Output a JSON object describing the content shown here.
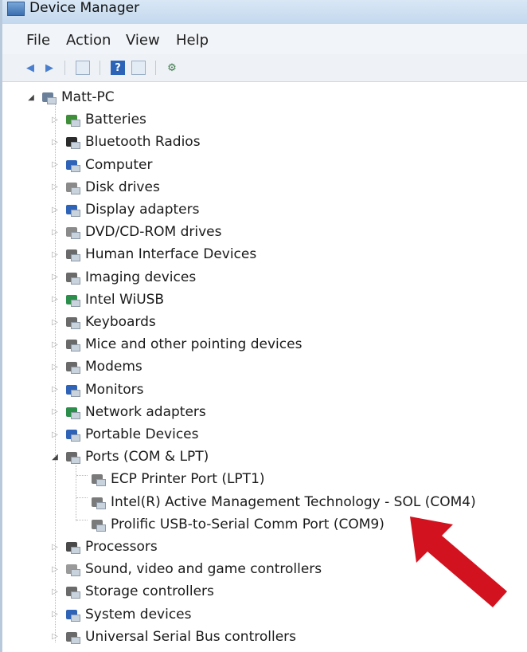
{
  "window": {
    "title": "Device Manager"
  },
  "menu": [
    "File",
    "Action",
    "View",
    "Help"
  ],
  "tree": {
    "root": "Matt-PC",
    "categories": [
      {
        "label": "Batteries",
        "icon": "battery-icon",
        "color": "#3f8f3a"
      },
      {
        "label": "Bluetooth Radios",
        "icon": "bluetooth-icon",
        "color": "#2b2b2b"
      },
      {
        "label": "Computer",
        "icon": "computer-icon",
        "color": "#2f63b7"
      },
      {
        "label": "Disk drives",
        "icon": "disk-drive-icon",
        "color": "#8a8a8a"
      },
      {
        "label": "Display adapters",
        "icon": "display-adapter-icon",
        "color": "#2f63b7"
      },
      {
        "label": "DVD/CD-ROM drives",
        "icon": "dvd-drive-icon",
        "color": "#8a8a8a"
      },
      {
        "label": "Human Interface Devices",
        "icon": "hid-icon",
        "color": "#6a6a6a"
      },
      {
        "label": "Imaging devices",
        "icon": "imaging-icon",
        "color": "#6a6a6a"
      },
      {
        "label": "Intel WiUSB",
        "icon": "network-icon",
        "color": "#2b8f4b"
      },
      {
        "label": "Keyboards",
        "icon": "keyboard-icon",
        "color": "#6a6a6a"
      },
      {
        "label": "Mice and other pointing devices",
        "icon": "mouse-icon",
        "color": "#6a6a6a"
      },
      {
        "label": "Modems",
        "icon": "modem-icon",
        "color": "#6a6a6a"
      },
      {
        "label": "Monitors",
        "icon": "monitor-icon",
        "color": "#2f63b7"
      },
      {
        "label": "Network adapters",
        "icon": "network-icon",
        "color": "#2b8f4b"
      },
      {
        "label": "Portable Devices",
        "icon": "portable-device-icon",
        "color": "#2f63b7"
      },
      {
        "label": "Ports (COM & LPT)",
        "icon": "port-icon",
        "color": "#6a6a6a",
        "expanded": true
      },
      {
        "label": "Processors",
        "icon": "processor-icon",
        "color": "#4a4a4a"
      },
      {
        "label": "Sound, video and game controllers",
        "icon": "sound-icon",
        "color": "#9a9a9a"
      },
      {
        "label": "Storage controllers",
        "icon": "storage-controller-icon",
        "color": "#6a6a6a"
      },
      {
        "label": "System devices",
        "icon": "system-device-icon",
        "color": "#2f63b7"
      },
      {
        "label": "Universal Serial Bus controllers",
        "icon": "usb-icon",
        "color": "#6a6a6a"
      }
    ],
    "ports_children": [
      "ECP Printer Port (LPT1)",
      "Intel(R) Active Management Technology - SOL (COM4)",
      "Prolific USB-to-Serial Comm Port (COM9)"
    ]
  },
  "annotation": {
    "arrow_color": "#d3121f"
  }
}
